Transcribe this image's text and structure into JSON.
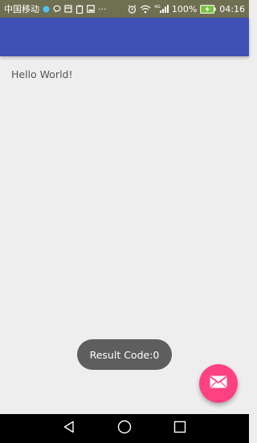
{
  "status_bar": {
    "carrier": "中国移动",
    "battery": "100%",
    "time": "04:16",
    "network": "4G",
    "overflow": "···"
  },
  "content": {
    "text": "Hello World!"
  },
  "toast": {
    "message": "Result Code:0"
  },
  "fab": {
    "icon": "email-icon"
  },
  "colors": {
    "primary": "#3f51b5",
    "accent": "#ff4081",
    "background": "#eeeeee"
  }
}
